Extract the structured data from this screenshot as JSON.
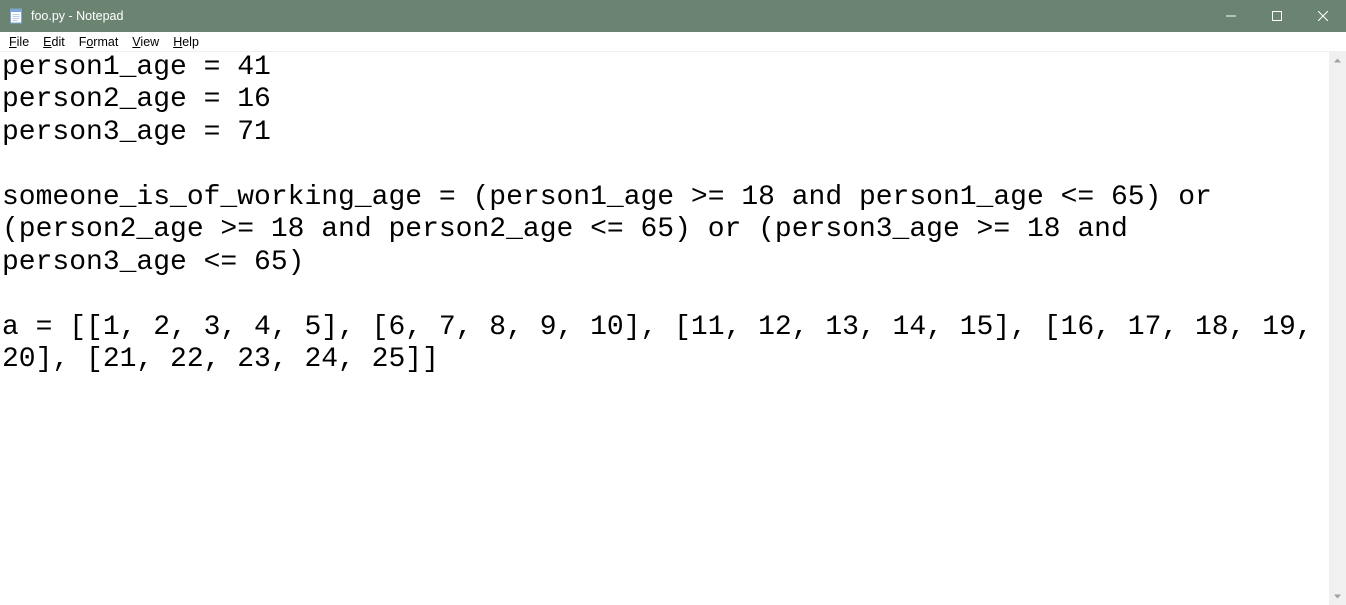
{
  "titlebar": {
    "title": "foo.py - Notepad"
  },
  "menu": {
    "file": "File",
    "edit": "Edit",
    "format": "Format",
    "view": "View",
    "help": "Help"
  },
  "editor": {
    "content": "person1_age = 41\nperson2_age = 16\nperson3_age = 71\n\nsomeone_is_of_working_age = (person1_age >= 18 and person1_age <= 65) or (person2_age >= 18 and person2_age <= 65) or (person3_age >= 18 and person3_age <= 65)\n\na = [[1, 2, 3, 4, 5], [6, 7, 8, 9, 10], [11, 12, 13, 14, 15], [16, 17, 18, 19, 20], [21, 22, 23, 24, 25]]\n"
  }
}
